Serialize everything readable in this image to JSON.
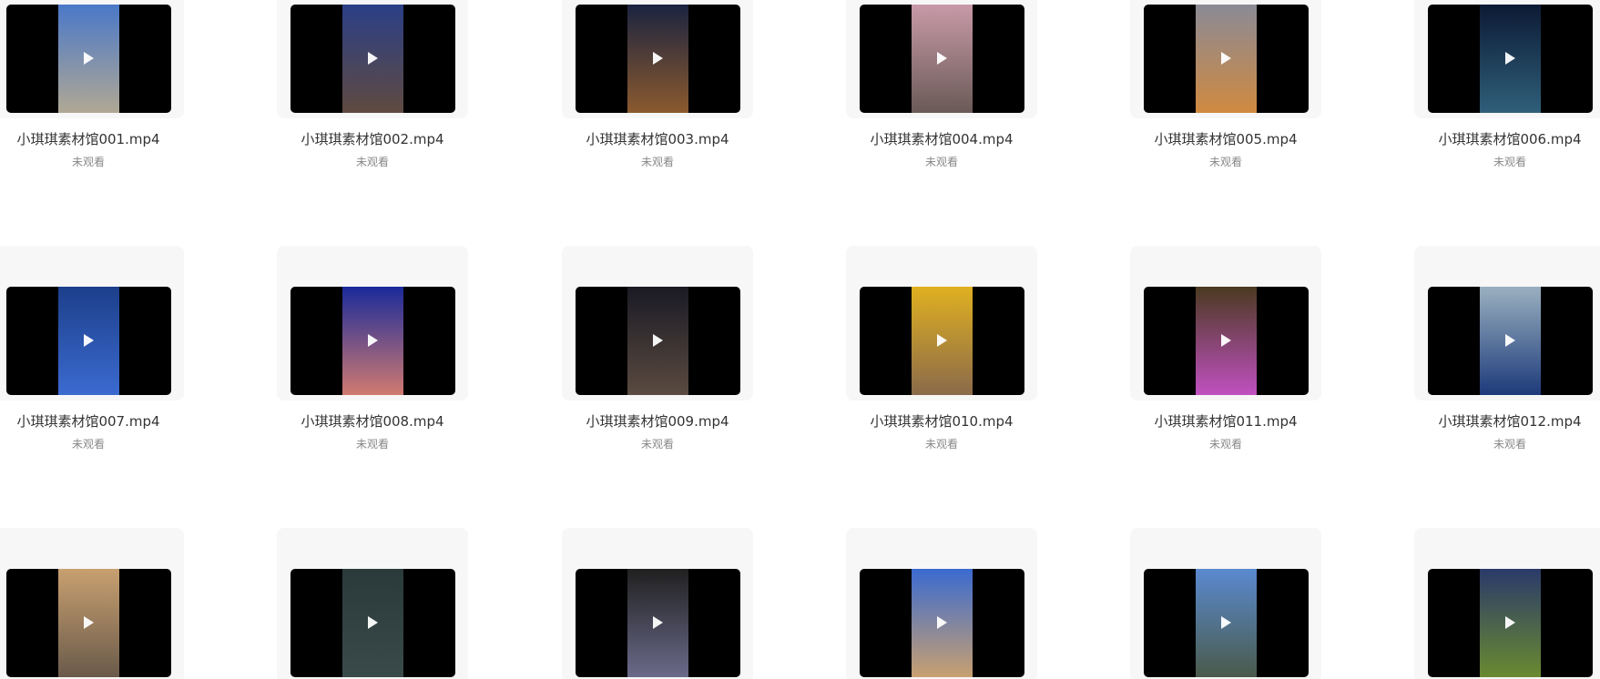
{
  "videos": [
    {
      "name": "小琪琪素材馆001.mp4",
      "status": "未观看",
      "thumb_colors": [
        "#4a78c8",
        "#b0a894"
      ]
    },
    {
      "name": "小琪琪素材馆002.mp4",
      "status": "未观看",
      "thumb_colors": [
        "#2b3f86",
        "#5f4a40"
      ]
    },
    {
      "name": "小琪琪素材馆003.mp4",
      "status": "未观看",
      "thumb_colors": [
        "#1b2340",
        "#8b5a2e"
      ]
    },
    {
      "name": "小琪琪素材馆004.mp4",
      "status": "未观看",
      "thumb_colors": [
        "#c89aa8",
        "#6a5a56"
      ]
    },
    {
      "name": "小琪琪素材馆005.mp4",
      "status": "未观看",
      "thumb_colors": [
        "#8a8a96",
        "#d08a40"
      ]
    },
    {
      "name": "小琪琪素材馆006.mp4",
      "status": "未观看",
      "thumb_colors": [
        "#0c1a34",
        "#2f5f7a"
      ]
    },
    {
      "name": "小琪琪素材馆007.mp4",
      "status": "未观看",
      "thumb_colors": [
        "#1c3f8a",
        "#3b6ad0"
      ]
    },
    {
      "name": "小琪琪素材馆008.mp4",
      "status": "未观看",
      "thumb_colors": [
        "#1a2a9a",
        "#d07a70"
      ]
    },
    {
      "name": "小琪琪素材馆009.mp4",
      "status": "未观看",
      "thumb_colors": [
        "#1a1a24",
        "#5a4a40"
      ]
    },
    {
      "name": "小琪琪素材馆010.mp4",
      "status": "未观看",
      "thumb_colors": [
        "#e0b020",
        "#8a6a4a"
      ]
    },
    {
      "name": "小琪琪素材馆011.mp4",
      "status": "未观看",
      "thumb_colors": [
        "#4a3a20",
        "#c050c0"
      ]
    },
    {
      "name": "小琪琪素材馆012.mp4",
      "status": "未观看",
      "thumb_colors": [
        "#9ab0c0",
        "#1d3a7a"
      ]
    },
    {
      "name": "",
      "status": "",
      "thumb_colors": [
        "#c8a070",
        "#6a5a4a"
      ]
    },
    {
      "name": "",
      "status": "",
      "thumb_colors": [
        "#2a3a3a",
        "#3a4a4a"
      ]
    },
    {
      "name": "",
      "status": "",
      "thumb_colors": [
        "#202020",
        "#6a6a8a"
      ]
    },
    {
      "name": "",
      "status": "",
      "thumb_colors": [
        "#3a6ad0",
        "#c8a070"
      ]
    },
    {
      "name": "",
      "status": "",
      "thumb_colors": [
        "#5a8ad0",
        "#4a5a4a"
      ]
    },
    {
      "name": "",
      "status": "",
      "thumb_colors": [
        "#2a3a6a",
        "#6a8a30"
      ]
    }
  ]
}
